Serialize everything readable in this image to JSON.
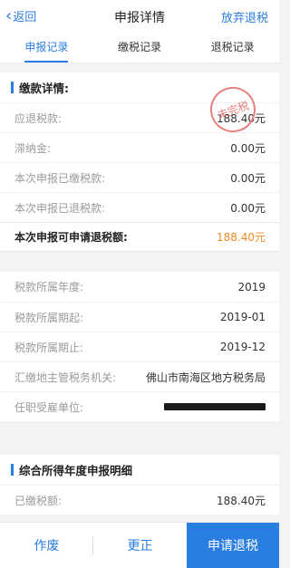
{
  "header": {
    "back_label": "返回",
    "title": "申报详情",
    "action_label": "放弃退税"
  },
  "tabs": [
    {
      "label": "申报记录",
      "active": true
    },
    {
      "label": "缴税记录",
      "active": false
    },
    {
      "label": "退税记录",
      "active": false
    }
  ],
  "payment_section": {
    "title": "缴款详情:",
    "stamp_text": "未完税",
    "rows": [
      {
        "label": "应退税款:",
        "value": "188.40元"
      },
      {
        "label": "滞纳金:",
        "value": "0.00元"
      },
      {
        "label": "本次申报已缴税款:",
        "value": "0.00元"
      },
      {
        "label": "本次申报已退税款:",
        "value": "0.00元"
      }
    ],
    "highlight": {
      "label": "本次申报可申请退税额:",
      "value": "188.40元"
    }
  },
  "info_rows": [
    {
      "label": "税款所属年度:",
      "value": "2019"
    },
    {
      "label": "税款所属期起:",
      "value": "2019-01"
    },
    {
      "label": "税款所属期止:",
      "value": "2019-12"
    },
    {
      "label": "汇缴地主管税务机关:",
      "value": "佛山市南海区地方税务局"
    },
    {
      "label": "任职受雇单位:",
      "value": ""
    }
  ],
  "annual_section": {
    "title": "综合所得年度申报明细",
    "rows": [
      {
        "label": "已缴税额:",
        "value": "188.40元"
      }
    ]
  },
  "footer": {
    "void_label": "作废",
    "correct_label": "更正",
    "apply_label": "申请退税"
  }
}
